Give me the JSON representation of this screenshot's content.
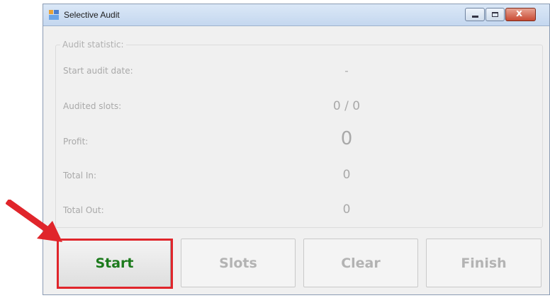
{
  "window": {
    "title": "Selective Audit"
  },
  "stats": {
    "legend": "Audit statistic:",
    "rows": [
      {
        "label": "Start audit date:",
        "value": "-"
      },
      {
        "label": "Audited slots:",
        "value": "0 / 0"
      },
      {
        "label": "Profit:",
        "value": "0"
      },
      {
        "label": "Total In:",
        "value": "0"
      },
      {
        "label": "Total Out:",
        "value": "0"
      }
    ]
  },
  "buttons": {
    "start": "Start",
    "slots": "Slots",
    "clear": "Clear",
    "finish": "Finish"
  },
  "colors": {
    "start_text": "#1c7a1c",
    "disabled_text": "#b3b3b3",
    "highlight": "#e0252b",
    "arrow": "#e0252b"
  }
}
